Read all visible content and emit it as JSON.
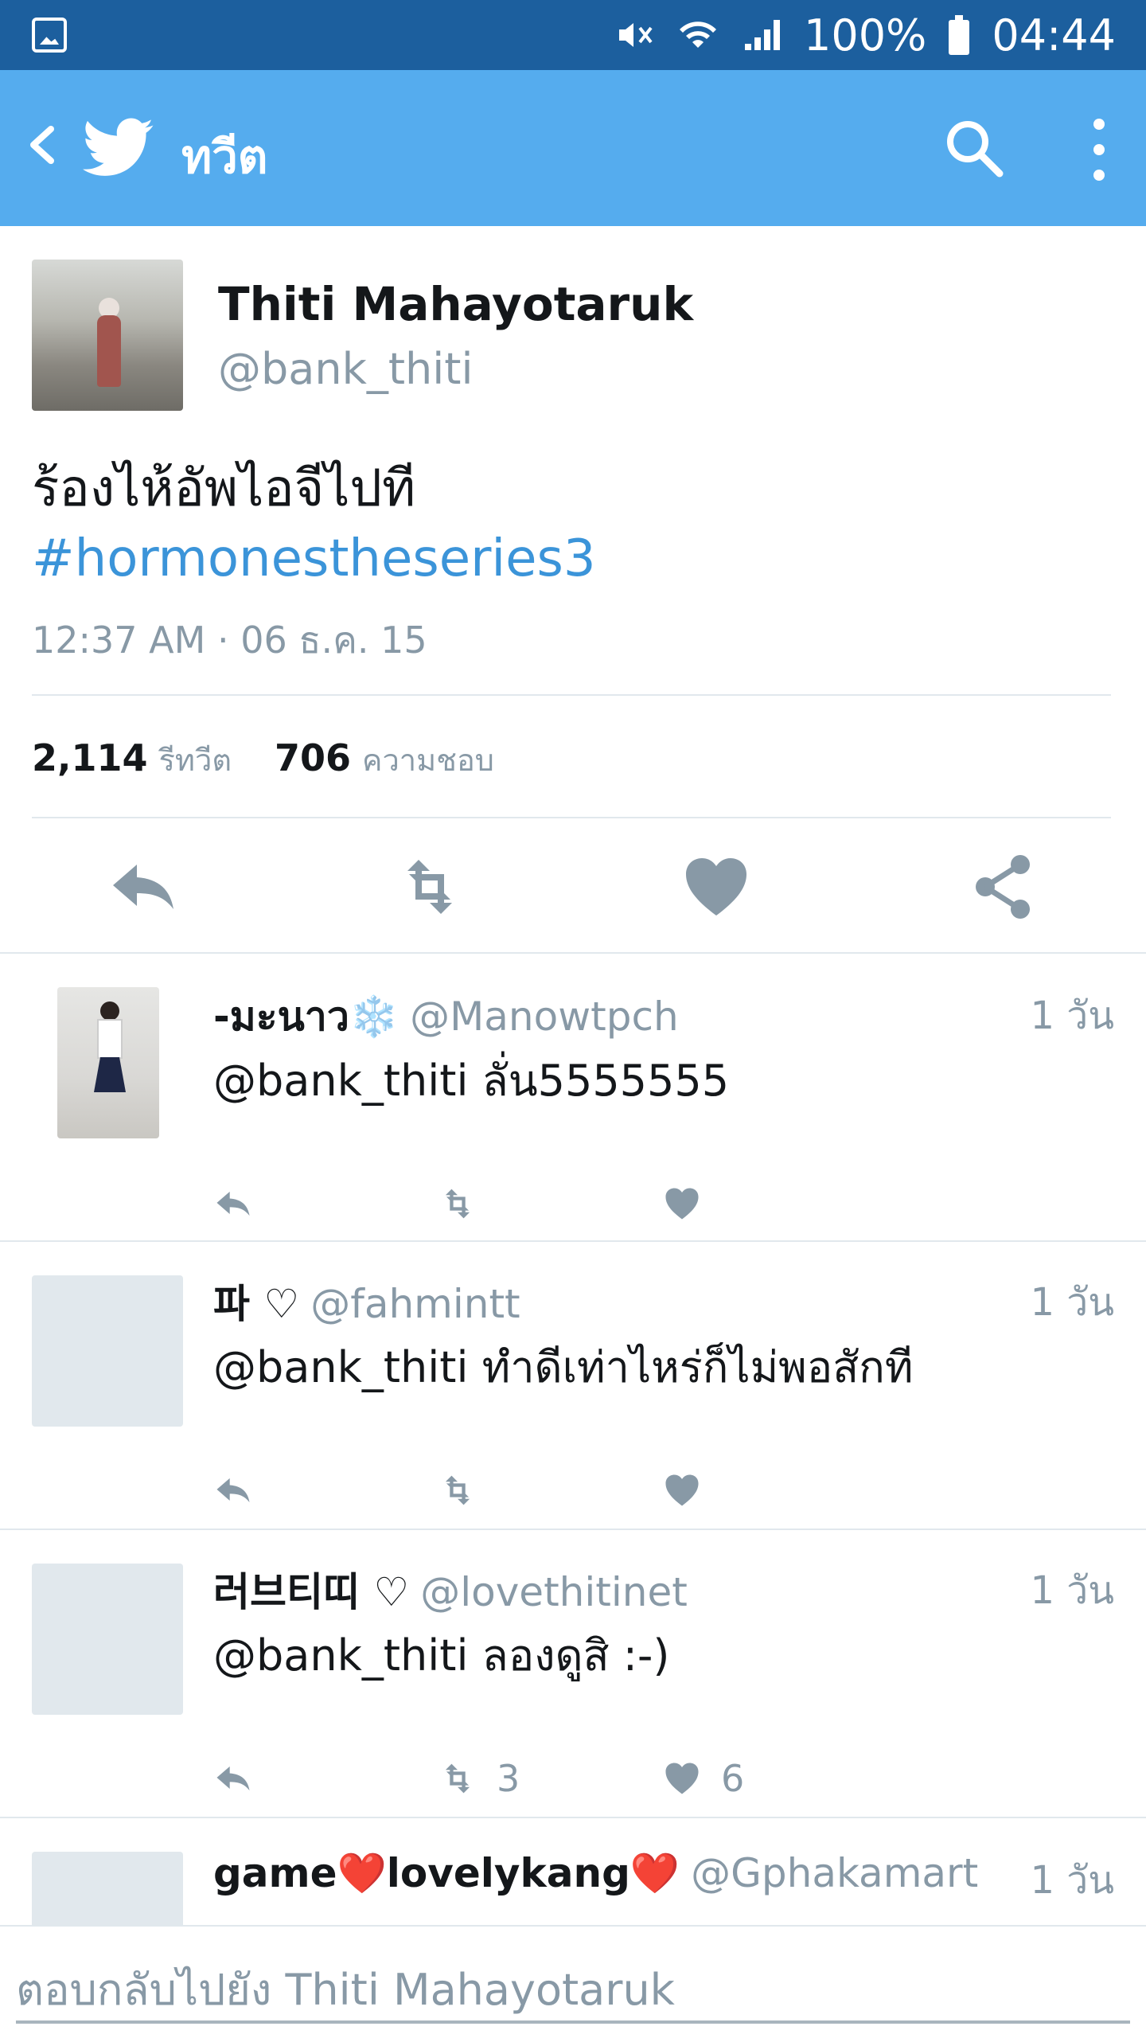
{
  "status_bar": {
    "battery": "100%",
    "time": "04:44"
  },
  "app_bar": {
    "title": "ทวีต"
  },
  "tweet": {
    "name": "Thiti Mahayotaruk",
    "handle": "@bank_thiti",
    "text": "ร้องไห้อัพไอจีไปที",
    "hashtag": "#hormonestheseries3",
    "timestamp": "12:37 AM · 06 ธ.ค. 15",
    "retweets": "2,114",
    "retweets_label": "รีทวีต",
    "likes": "706",
    "likes_label": "ความชอบ"
  },
  "replies": [
    {
      "name": "-มะนาว❄️",
      "handle": "@Manowtpch",
      "time": "1 วัน",
      "text": "@bank_thiti ลั่น5555555",
      "retweet_count": "",
      "like_count": ""
    },
    {
      "name": "파 ♡",
      "handle": "@fahmintt",
      "time": "1 วัน",
      "text": "@bank_thiti ทำดีเท่าไหร่ก็ไม่พอสักที",
      "retweet_count": "",
      "like_count": ""
    },
    {
      "name": "러브티띠 ♡",
      "handle": "@lovethitinet",
      "time": "1 วัน",
      "text": "@bank_thiti ลองดูสิ :-)",
      "retweet_count": "3",
      "like_count": "6"
    },
    {
      "name": "game❤️lovelykang❤️",
      "handle": "@Gphakamart",
      "time": "1 วัน",
      "text": "",
      "retweet_count": "",
      "like_count": ""
    }
  ],
  "reply_bar": {
    "placeholder": "ตอบกลับไปยัง Thiti Mahayotaruk"
  },
  "colors": {
    "status_bar": "#1c5f9e",
    "app_bar": "#55acee",
    "icon_gray": "#8899a6",
    "link": "#3b94d9"
  }
}
